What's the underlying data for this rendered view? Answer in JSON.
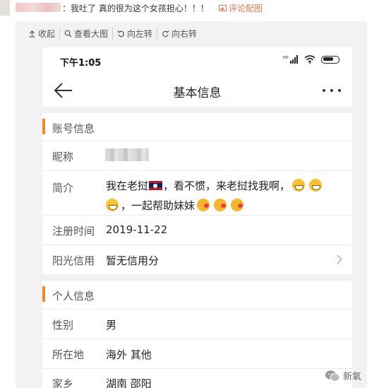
{
  "comment": {
    "text": "：我吐了 真的很为这个女孩担心！！！",
    "pic_link": "评论配图",
    "pic_icon": "image-icon"
  },
  "toolbar": {
    "items": [
      {
        "label": "收起",
        "icon": "collapse-icon"
      },
      {
        "label": "查看大图",
        "icon": "magnify-icon"
      },
      {
        "label": "向左转",
        "icon": "rotate-left-icon"
      },
      {
        "label": "向右转",
        "icon": "rotate-right-icon"
      }
    ]
  },
  "phone": {
    "status_time": "下午1:05",
    "status_hd": "HD",
    "nav_title": "基本信息",
    "sections": {
      "account": "账号信息",
      "personal": "个人信息"
    },
    "account_rows": {
      "nickname_key": "昵称",
      "bio_key": "简介",
      "bio_part1": "我在老挝",
      "bio_part2": "，看不惯，来老挝找我啊，",
      "bio_part3": "，一起帮助妹妹",
      "register_key": "注册时间",
      "register_val": "2019-11-22",
      "credit_key": "阳光信用",
      "credit_val": "暂无信用分"
    },
    "personal_rows": {
      "gender_key": "性别",
      "gender_val": "男",
      "location_key": "所在地",
      "location_val": "海外 其他",
      "hometown_key": "家乡",
      "hometown_val": "湖南 邵阳"
    }
  },
  "watermark": "新氧",
  "colors": {
    "accent": "#ef8a2a",
    "link": "#eb7350",
    "panel_bg": "#f2f2f5"
  }
}
